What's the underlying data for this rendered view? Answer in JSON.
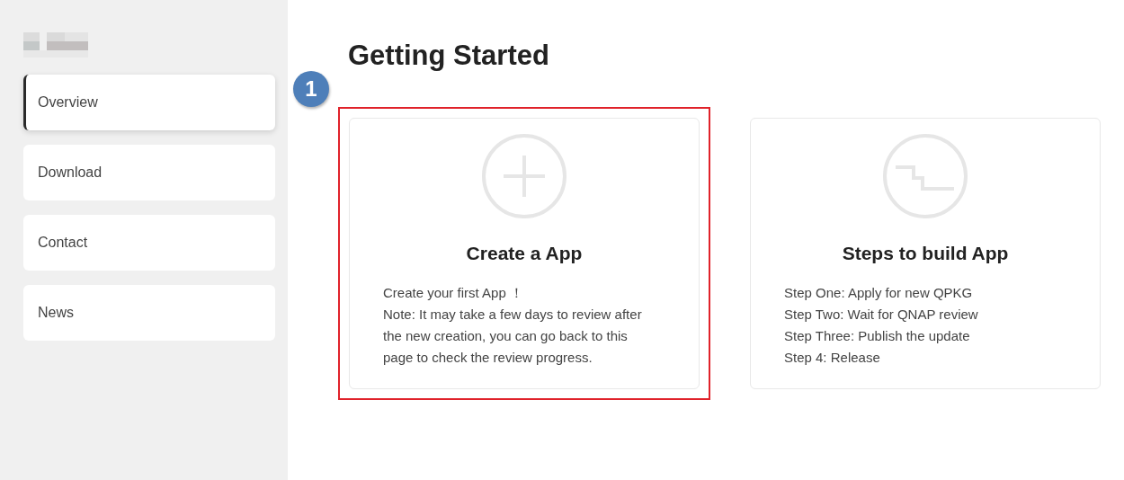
{
  "sidebar": {
    "items": [
      {
        "label": "Overview",
        "selected": true
      },
      {
        "label": "Download",
        "selected": false
      },
      {
        "label": "Contact",
        "selected": false
      },
      {
        "label": "News",
        "selected": false
      }
    ]
  },
  "main": {
    "title": "Getting Started",
    "callout_badge": "1",
    "cards": [
      {
        "kind": "create",
        "title": "Create a App",
        "highlighted": true,
        "lines": [
          "Create your first App ！",
          "Note: It may take a few days to review after",
          "the new creation, you can go back to this",
          "page to check the review progress."
        ]
      },
      {
        "kind": "steps",
        "title": "Steps to build App",
        "highlighted": false,
        "lines": [
          "Step One: Apply for new QPKG",
          "Step Two: Wait for QNAP review",
          "Step Three: Publish the update",
          "Step 4: Release"
        ]
      }
    ]
  }
}
